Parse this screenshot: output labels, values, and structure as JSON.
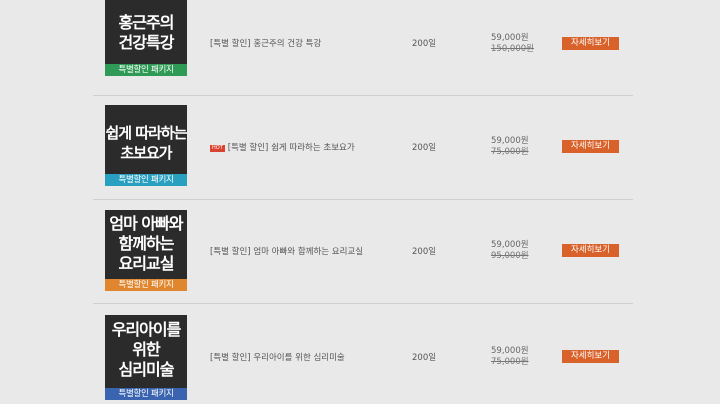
{
  "colors": {
    "button": "#d9622b",
    "thumb_bg": "#2b2b2b"
  },
  "items": [
    {
      "thumb_title": "홍근주의\n건강특강",
      "thumb_band": "특별할인 패키지",
      "band_color": "#2f9a55",
      "hot": false,
      "hot_label": "",
      "name": "[특별 할인] 홍근주의 건강 특강",
      "days": "200일",
      "price": "59,000원",
      "original_price": "150,000원",
      "button": "자세히보기"
    },
    {
      "thumb_title": "쉽게 따라하는\n초보요가",
      "thumb_band": "특별할인 패키지",
      "band_color": "#2aa0c0",
      "hot": true,
      "hot_label": "HOT",
      "name": "[특별 할인] 쉽게 따라하는 초보요가",
      "days": "200일",
      "price": "59,000원",
      "original_price": "75,000원",
      "button": "자세히보기"
    },
    {
      "thumb_title": "엄마 아빠와\n함께하는\n요리교실",
      "thumb_band": "특별할인 패키지",
      "band_color": "#e0862e",
      "hot": false,
      "hot_label": "",
      "name": "[특별 할인] 엄마 아빠와 함께하는 요리교실",
      "days": "200일",
      "price": "59,000원",
      "original_price": "95,000원",
      "button": "자세히보기"
    },
    {
      "thumb_title": "우리아이를\n위한\n심리미술",
      "thumb_band": "특별할인 패키지",
      "band_color": "#3b64b0",
      "hot": false,
      "hot_label": "",
      "name": "[특별 할인] 우리아이를 위한 심리미술",
      "days": "200일",
      "price": "59,000원",
      "original_price": "75,000원",
      "button": "자세히보기"
    }
  ]
}
